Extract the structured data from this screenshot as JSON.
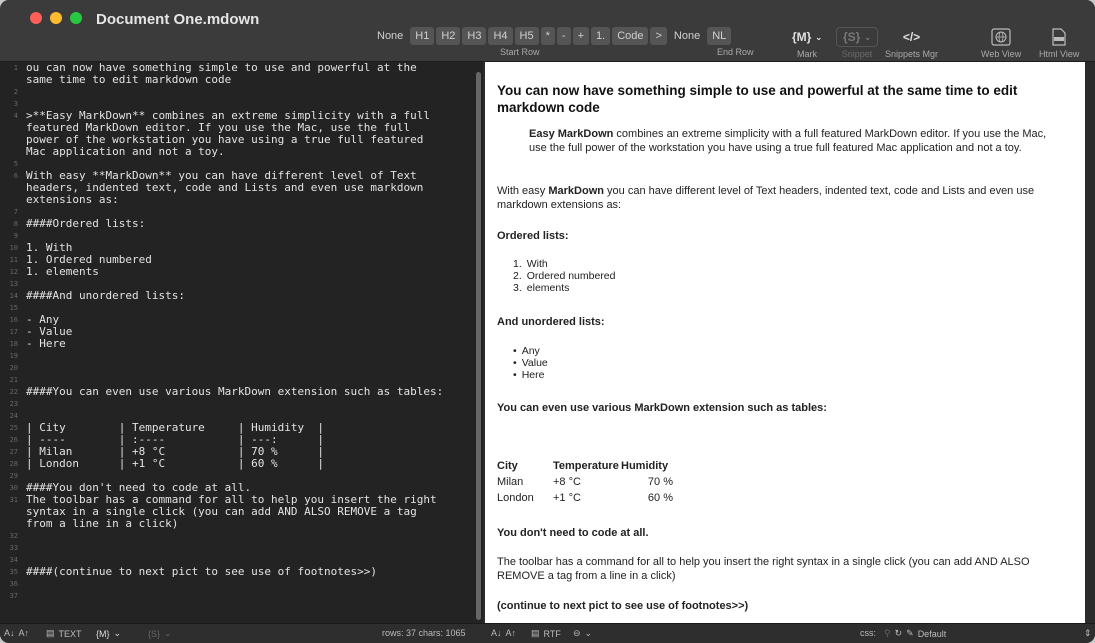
{
  "window": {
    "title": "Document One.mdown"
  },
  "toolbar": {
    "headers": [
      "None",
      "H1",
      "H2",
      "H3",
      "H4",
      "H5",
      "*",
      "-",
      "+",
      "1.",
      "Code",
      ">",
      "None",
      "NL"
    ],
    "start_row_label": "Start Row",
    "end_row_label": "End Row",
    "mark": {
      "value": "{M}",
      "label": "Mark"
    },
    "snippet": {
      "value": "{S}",
      "label": "Snippet"
    },
    "snippets_mgr": {
      "value": "</>",
      "label": "Snippets Mgr"
    },
    "web_view": {
      "label": "Web View"
    },
    "html_view": {
      "label": "Html View"
    }
  },
  "editor": {
    "lines": [
      "ou can now have something simple to use and powerful at the",
      "same time to edit markdown code",
      "",
      "",
      ">**Easy MarkDown** combines an extreme simplicity with a full",
      "featured MarkDown editor. If you use the Mac, use the full",
      "power of the workstation you have using a true full featured",
      "Mac application and not a toy.",
      "",
      "With easy **MarkDown** you can have different level of Text",
      "headers, indented text, code and Lists and even use markdown",
      "extensions as:",
      "",
      "####Ordered lists:",
      "",
      "1. With",
      "1. Ordered numbered",
      "1. elements",
      "",
      "####And unordered lists:",
      "",
      "- Any",
      "- Value",
      "- Here",
      "",
      "",
      "",
      "####You can even use various MarkDown extension such as tables:",
      "",
      "",
      "| City        | Temperature     | Humidity  |",
      "| ----        | :----           | ---:      |",
      "| Milan       | +8 °C           | 70 %      |",
      "| London      | +1 °C           | 60 %      |",
      "",
      "####You don't need to code at all.",
      "The toolbar has a command for all to help you insert the right",
      "syntax in a single click (you can add AND ALSO REMOVE a tag",
      "from a line in a click)",
      "",
      "",
      "",
      "####(continue to next pict to see use of footnotes>>)",
      "",
      "",
      ""
    ],
    "line_numbers": [
      "1",
      "2",
      "3",
      "4",
      "5",
      "6",
      "7",
      "8",
      "9",
      "10",
      "11",
      "12",
      "13",
      "14",
      "15",
      "16",
      "17",
      "18",
      "19",
      "20",
      "21",
      "22",
      "23",
      "24",
      "25",
      "26",
      "27",
      "28",
      "29",
      "30",
      "31",
      "32",
      "33",
      "34",
      "35",
      "36",
      "37"
    ]
  },
  "preview": {
    "h1": "You can now have something simple to use and powerful at the same time to edit markdown code",
    "quote_bold": "Easy MarkDown",
    "quote_rest": " combines an extreme simplicity with a full featured MarkDown editor. If you use the Mac, use the full power of the workstation you have using a true full featured Mac application and not a toy.",
    "p1_a": "With easy ",
    "p1_bold": "MarkDown",
    "p1_b": " you can have different level of Text headers, indented text, code and Lists and even use markdown extensions as:",
    "h_ordered": "Ordered lists:",
    "ordered": [
      "With",
      "Ordered numbered",
      "elements"
    ],
    "h_unordered": "And unordered lists:",
    "unordered": [
      "Any",
      "Value",
      "Here"
    ],
    "h_tables": "You can even use various MarkDown extension such as tables:",
    "table": {
      "headers": [
        "City",
        "Temperature",
        "Humidity"
      ],
      "rows": [
        [
          "Milan",
          "+8 °C",
          "70 %"
        ],
        [
          "London",
          "+1 °C",
          "60 %"
        ]
      ]
    },
    "h_code": "You don't need to code at all.",
    "p2": "The toolbar has a command for all to help you insert the right syntax in a single click (you can add AND ALSO REMOVE a tag from a line in a click)",
    "h_continue": "(continue to next pict to see use of footnotes>>)"
  },
  "status_left": {
    "mode": "TEXT",
    "mark": "{M}",
    "snippet": "{S}",
    "info": "rows: 37 chars: 1065"
  },
  "status_right": {
    "mode": "RTF",
    "css_label": "css:",
    "css_value": "Default"
  }
}
